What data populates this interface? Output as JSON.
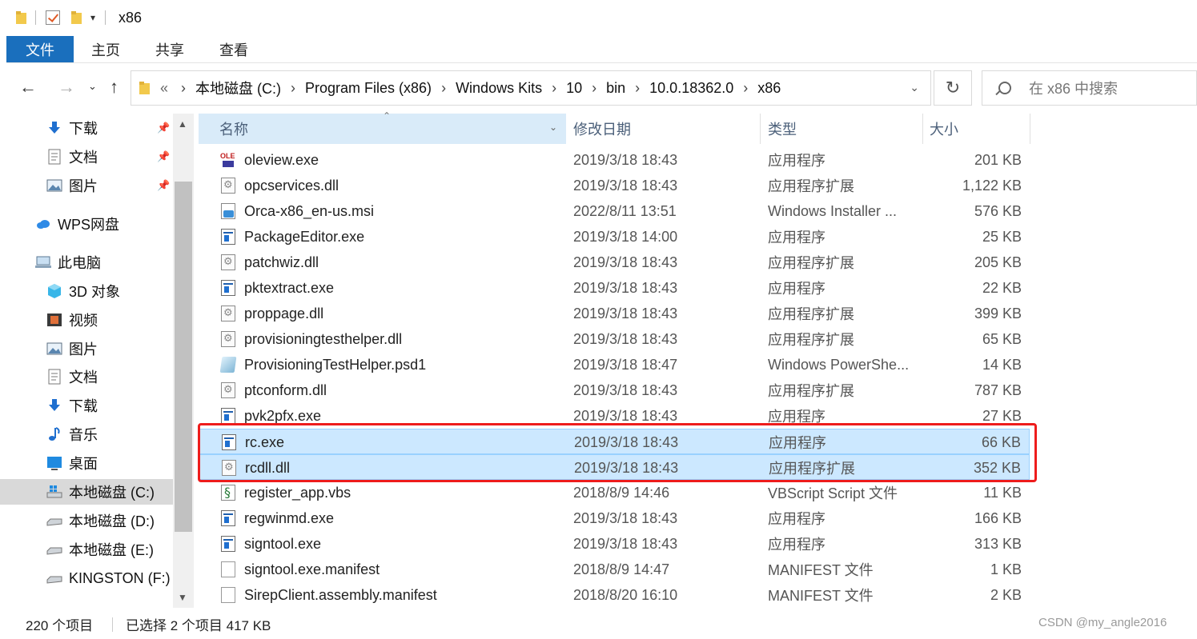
{
  "window": {
    "title": "x86"
  },
  "ribbon": {
    "tabs": [
      "文件",
      "主页",
      "共享",
      "查看"
    ]
  },
  "address": {
    "crumbs": [
      "本地磁盘 (C:)",
      "Program Files (x86)",
      "Windows Kits",
      "10",
      "bin",
      "10.0.18362.0",
      "x86"
    ],
    "overflow": "«"
  },
  "search": {
    "placeholder": "在 x86 中搜索"
  },
  "sidebar": {
    "items": [
      {
        "label": "下载",
        "icon": "download-arrow-icon",
        "pinned": true
      },
      {
        "label": "文档",
        "icon": "document-icon",
        "pinned": true
      },
      {
        "label": "图片",
        "icon": "picture-icon",
        "pinned": true
      },
      {
        "label": "WPS网盘",
        "icon": "cloud-icon"
      },
      {
        "label": "此电脑",
        "icon": "computer-icon"
      },
      {
        "label": "3D 对象",
        "icon": "cube-icon"
      },
      {
        "label": "视频",
        "icon": "video-icon"
      },
      {
        "label": "图片",
        "icon": "picture-icon"
      },
      {
        "label": "文档",
        "icon": "document-icon"
      },
      {
        "label": "下载",
        "icon": "download-arrow-icon"
      },
      {
        "label": "音乐",
        "icon": "music-note-icon"
      },
      {
        "label": "桌面",
        "icon": "desktop-icon"
      },
      {
        "label": "本地磁盘 (C:)",
        "icon": "windows-drive-icon",
        "selected": true
      },
      {
        "label": "本地磁盘 (D:)",
        "icon": "drive-icon"
      },
      {
        "label": "本地磁盘 (E:)",
        "icon": "drive-icon"
      },
      {
        "label": "KINGSTON (F:)",
        "icon": "drive-icon"
      }
    ]
  },
  "columns": {
    "name": "名称",
    "date": "修改日期",
    "type": "类型",
    "size": "大小"
  },
  "files": [
    {
      "name": "oleview.exe",
      "date": "2019/3/18 18:43",
      "type": "应用程序",
      "size": "201 KB",
      "icon": "ole"
    },
    {
      "name": "opcservices.dll",
      "date": "2019/3/18 18:43",
      "type": "应用程序扩展",
      "size": "1,122 KB",
      "icon": "dll"
    },
    {
      "name": "Orca-x86_en-us.msi",
      "date": "2022/8/11 13:51",
      "type": "Windows Installer ...",
      "size": "576 KB",
      "icon": "msi"
    },
    {
      "name": "PackageEditor.exe",
      "date": "2019/3/18 14:00",
      "type": "应用程序",
      "size": "25 KB",
      "icon": "exe"
    },
    {
      "name": "patchwiz.dll",
      "date": "2019/3/18 18:43",
      "type": "应用程序扩展",
      "size": "205 KB",
      "icon": "dll"
    },
    {
      "name": "pktextract.exe",
      "date": "2019/3/18 18:43",
      "type": "应用程序",
      "size": "22 KB",
      "icon": "exe"
    },
    {
      "name": "proppage.dll",
      "date": "2019/3/18 18:43",
      "type": "应用程序扩展",
      "size": "399 KB",
      "icon": "dll"
    },
    {
      "name": "provisioningtesthelper.dll",
      "date": "2019/3/18 18:43",
      "type": "应用程序扩展",
      "size": "65 KB",
      "icon": "dll"
    },
    {
      "name": "ProvisioningTestHelper.psd1",
      "date": "2019/3/18 18:47",
      "type": "Windows PowerShe...",
      "size": "14 KB",
      "icon": "ps"
    },
    {
      "name": "ptconform.dll",
      "date": "2019/3/18 18:43",
      "type": "应用程序扩展",
      "size": "787 KB",
      "icon": "dll"
    },
    {
      "name": "pvk2pfx.exe",
      "date": "2019/3/18 18:43",
      "type": "应用程序",
      "size": "27 KB",
      "icon": "exe"
    },
    {
      "name": "rc.exe",
      "date": "2019/3/18 18:43",
      "type": "应用程序",
      "size": "66 KB",
      "icon": "exe",
      "selected": true
    },
    {
      "name": "rcdll.dll",
      "date": "2019/3/18 18:43",
      "type": "应用程序扩展",
      "size": "352 KB",
      "icon": "dll",
      "selected": true
    },
    {
      "name": "register_app.vbs",
      "date": "2018/8/9 14:46",
      "type": "VBScript Script 文件",
      "size": "11 KB",
      "icon": "vbs"
    },
    {
      "name": "regwinmd.exe",
      "date": "2019/3/18 18:43",
      "type": "应用程序",
      "size": "166 KB",
      "icon": "exe"
    },
    {
      "name": "signtool.exe",
      "date": "2019/3/18 18:43",
      "type": "应用程序",
      "size": "313 KB",
      "icon": "exe"
    },
    {
      "name": "signtool.exe.manifest",
      "date": "2018/8/9 14:47",
      "type": "MANIFEST 文件",
      "size": "1 KB",
      "icon": "doc"
    },
    {
      "name": "SirepClient.assembly.manifest",
      "date": "2018/8/20 16:10",
      "type": "MANIFEST 文件",
      "size": "2 KB",
      "icon": "doc"
    }
  ],
  "status": {
    "count": "220 个项目",
    "selection": "已选择 2 个项目  417 KB"
  },
  "watermark": "CSDN @my_angle2016",
  "colors": {
    "accent": "#1a6fbd",
    "selection": "#cce8ff",
    "highlight": "#ee1c1c"
  }
}
